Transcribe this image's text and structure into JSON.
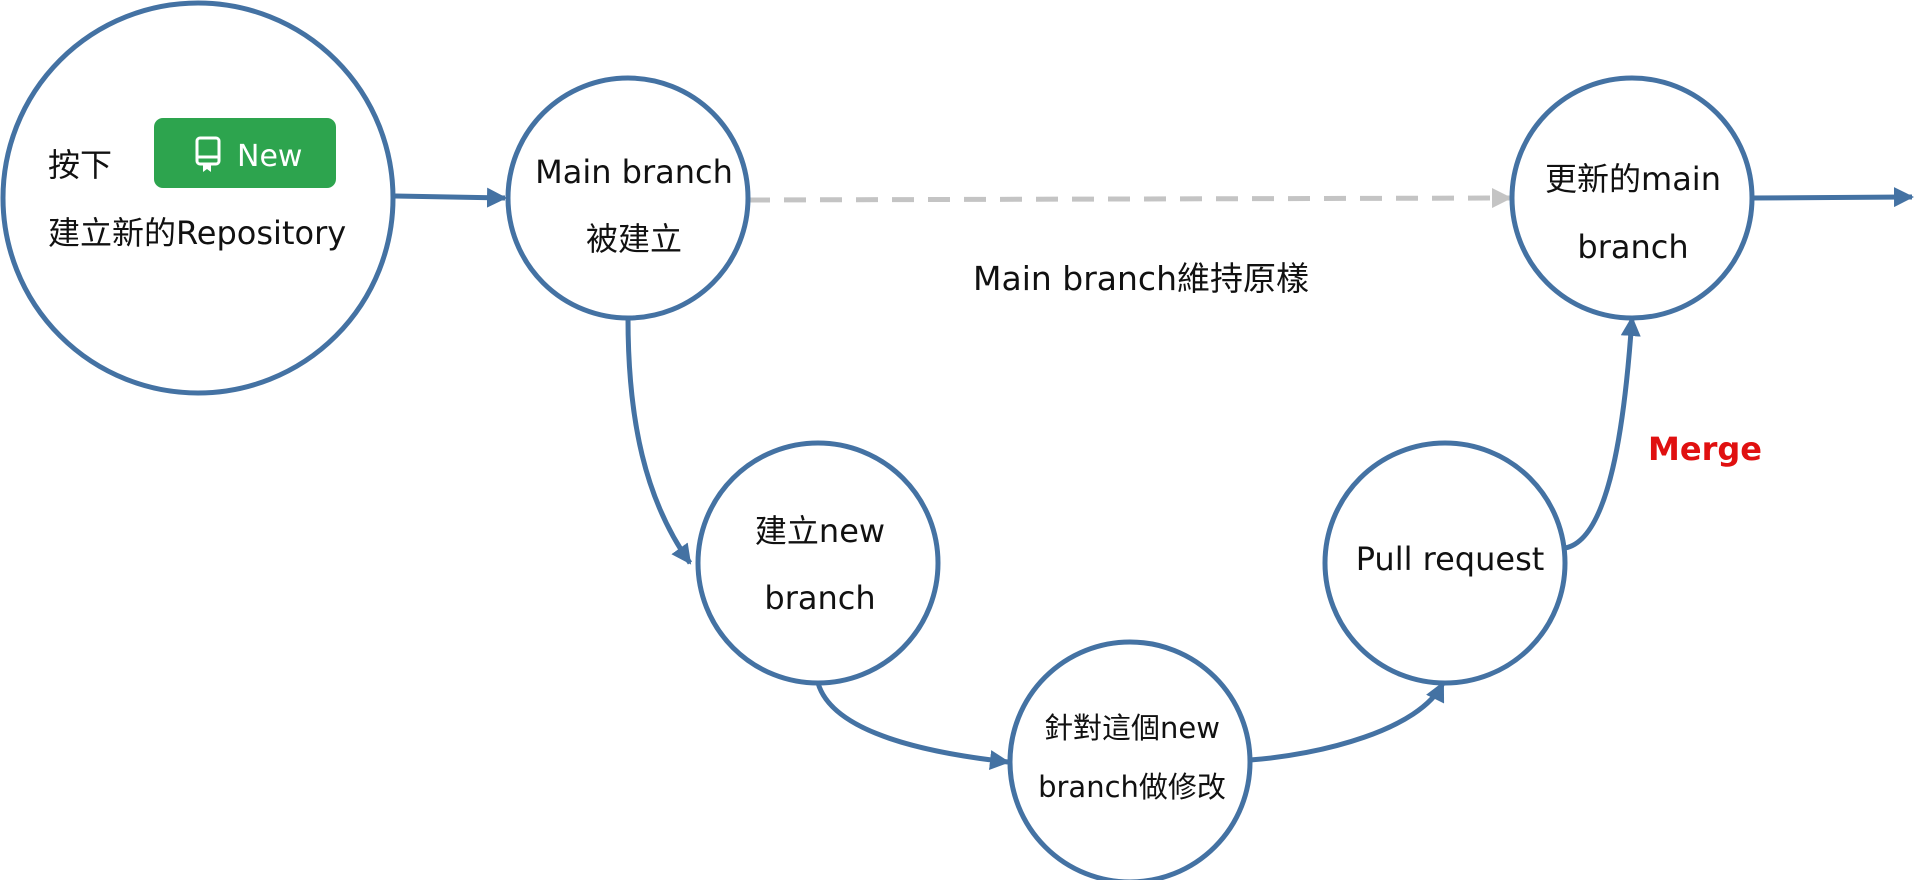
{
  "colors": {
    "node_stroke": "#4472a3",
    "dashed_arrow": "#c4c4c4",
    "merge_label": "#e01010",
    "new_button_bg": "#2da44e",
    "new_button_text": "#ffffff"
  },
  "nodes": {
    "create_repo": {
      "line1": "按下",
      "line2": "建立新的Repository",
      "button": {
        "label": "New",
        "icon": "repo-book-icon"
      }
    },
    "main_created": {
      "line1": "Main branch",
      "line2": "被建立"
    },
    "create_new_branch": {
      "line1": "建立new",
      "line2": "branch"
    },
    "modify_branch": {
      "line1": "針對這個new",
      "line2": "branch做修改"
    },
    "pull_request": {
      "line1": "Pull request"
    },
    "updated_main": {
      "line1": "更新的main",
      "line2": "branch"
    }
  },
  "labels": {
    "main_unchanged": "Main branch維持原樣",
    "merge": "Merge"
  }
}
